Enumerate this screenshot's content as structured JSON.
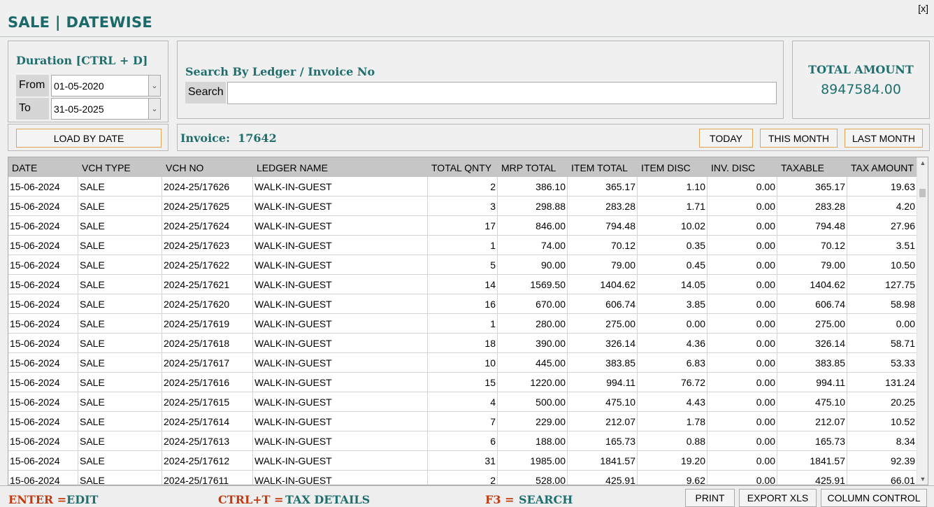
{
  "window": {
    "close_label": "[x]",
    "title": "SALE | DATEWISE"
  },
  "duration": {
    "title": "Duration [CTRL + D]",
    "from_label": "From",
    "from_value": "01-05-2020",
    "to_label": "To",
    "to_value": "31-05-2025",
    "load_button": "LOAD BY DATE"
  },
  "search": {
    "title": "Search By Ledger / Invoice No",
    "label": "Search",
    "value": ""
  },
  "total": {
    "label": "TOTAL AMOUNT",
    "value": "8947584.00"
  },
  "invoice": {
    "label": "Invoice:",
    "value": "17642"
  },
  "quick_buttons": {
    "today": "TODAY",
    "this_month": "THIS MONTH",
    "last_month": "LAST MONTH"
  },
  "grid": {
    "columns": [
      "DATE",
      "VCH TYPE",
      "VCH NO",
      "LEDGER NAME",
      "TOTAL QNTY",
      "MRP TOTAL",
      "ITEM TOTAL",
      "ITEM DISC",
      "INV. DISC",
      "TAXABLE",
      "TAX AMOUNT"
    ],
    "rows": [
      [
        "15-06-2024",
        "SALE",
        "2024-25/17626",
        "WALK-IN-GUEST",
        "2",
        "386.10",
        "365.17",
        "1.10",
        "0.00",
        "365.17",
        "19.63"
      ],
      [
        "15-06-2024",
        "SALE",
        "2024-25/17625",
        "WALK-IN-GUEST",
        "3",
        "298.88",
        "283.28",
        "1.71",
        "0.00",
        "283.28",
        "4.20"
      ],
      [
        "15-06-2024",
        "SALE",
        "2024-25/17624",
        "WALK-IN-GUEST",
        "17",
        "846.00",
        "794.48",
        "10.02",
        "0.00",
        "794.48",
        "27.96"
      ],
      [
        "15-06-2024",
        "SALE",
        "2024-25/17623",
        "WALK-IN-GUEST",
        "1",
        "74.00",
        "70.12",
        "0.35",
        "0.00",
        "70.12",
        "3.51"
      ],
      [
        "15-06-2024",
        "SALE",
        "2024-25/17622",
        "WALK-IN-GUEST",
        "5",
        "90.00",
        "79.00",
        "0.45",
        "0.00",
        "79.00",
        "10.50"
      ],
      [
        "15-06-2024",
        "SALE",
        "2024-25/17621",
        "WALK-IN-GUEST",
        "14",
        "1569.50",
        "1404.62",
        "14.05",
        "0.00",
        "1404.62",
        "127.75"
      ],
      [
        "15-06-2024",
        "SALE",
        "2024-25/17620",
        "WALK-IN-GUEST",
        "16",
        "670.00",
        "606.74",
        "3.85",
        "0.00",
        "606.74",
        "58.98"
      ],
      [
        "15-06-2024",
        "SALE",
        "2024-25/17619",
        "WALK-IN-GUEST",
        "1",
        "280.00",
        "275.00",
        "0.00",
        "0.00",
        "275.00",
        "0.00"
      ],
      [
        "15-06-2024",
        "SALE",
        "2024-25/17618",
        "WALK-IN-GUEST",
        "18",
        "390.00",
        "326.14",
        "4.36",
        "0.00",
        "326.14",
        "58.71"
      ],
      [
        "15-06-2024",
        "SALE",
        "2024-25/17617",
        "WALK-IN-GUEST",
        "10",
        "445.00",
        "383.85",
        "6.83",
        "0.00",
        "383.85",
        "53.33"
      ],
      [
        "15-06-2024",
        "SALE",
        "2024-25/17616",
        "WALK-IN-GUEST",
        "15",
        "1220.00",
        "994.11",
        "76.72",
        "0.00",
        "994.11",
        "131.24"
      ],
      [
        "15-06-2024",
        "SALE",
        "2024-25/17615",
        "WALK-IN-GUEST",
        "4",
        "500.00",
        "475.10",
        "4.43",
        "0.00",
        "475.10",
        "20.25"
      ],
      [
        "15-06-2024",
        "SALE",
        "2024-25/17614",
        "WALK-IN-GUEST",
        "7",
        "229.00",
        "212.07",
        "1.78",
        "0.00",
        "212.07",
        "10.52"
      ],
      [
        "15-06-2024",
        "SALE",
        "2024-25/17613",
        "WALK-IN-GUEST",
        "6",
        "188.00",
        "165.73",
        "0.88",
        "0.00",
        "165.73",
        "8.34"
      ],
      [
        "15-06-2024",
        "SALE",
        "2024-25/17612",
        "WALK-IN-GUEST",
        "31",
        "1985.00",
        "1841.57",
        "19.20",
        "0.00",
        "1841.57",
        "92.39"
      ],
      [
        "15-06-2024",
        "SALE",
        "2024-25/17611",
        "WALK-IN-GUEST",
        "2",
        "528.00",
        "425.91",
        "9.62",
        "0.00",
        "425.91",
        "66.01"
      ]
    ]
  },
  "footer": {
    "enter_key": "ENTER =",
    "enter_action": "EDIT",
    "ctrl_key": "CTRL+T =",
    "ctrl_action": "TAX DETAILS",
    "f3_key": "F3 =",
    "f3_action": "SEARCH",
    "print": "PRINT",
    "export": "EXPORT XLS",
    "column_control": "COLUMN CONTROL"
  },
  "icons": {
    "dropdown": "chevron-down-icon",
    "scroll_up": "arrow-up-icon",
    "scroll_down": "arrow-down-icon"
  }
}
